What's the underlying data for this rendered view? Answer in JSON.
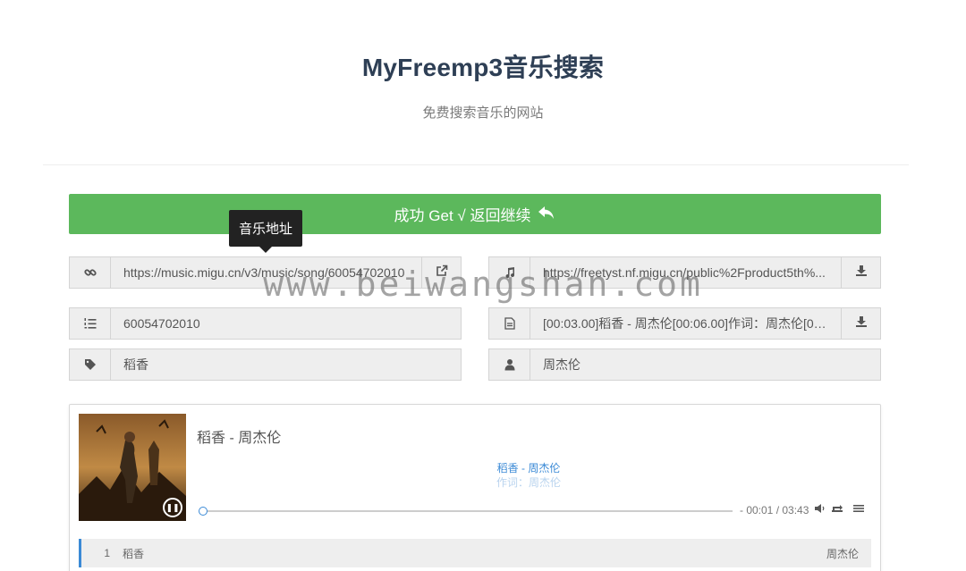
{
  "header": {
    "title": "MyFreemp3音乐搜索",
    "subtitle": "免费搜索音乐的网站"
  },
  "success_bar": {
    "label": "成功 Get √ 返回继续",
    "icon": "reply-icon",
    "color": "#5cb85c"
  },
  "tooltip": {
    "label": "音乐地址"
  },
  "fields": {
    "music_url": {
      "icon": "link-icon",
      "value": "https://music.migu.cn/v3/music/song/60054702010",
      "button_icon": "external-link-icon"
    },
    "file_url": {
      "icon": "music-note-icon",
      "value": "https://freetyst.nf.migu.cn/public%2Fproduct5th%...",
      "button_icon": "download-icon"
    },
    "song_id": {
      "icon": "list-ordered-icon",
      "value": "60054702010"
    },
    "lyrics": {
      "icon": "document-icon",
      "value": "[00:03.00]稻香 - 周杰伦[00:06.00]作词：周杰伦[00:...",
      "button_icon": "download-icon"
    },
    "song_name": {
      "icon": "tag-icon",
      "value": "稻香"
    },
    "artist": {
      "icon": "user-icon",
      "value": "周杰伦"
    }
  },
  "watermark": "www.beiwangshan.com",
  "player": {
    "title": "稻香 - 周杰伦",
    "lyric_current": "稻香 - 周杰伦",
    "lyric_next": "作词：周杰伦",
    "time": "- 00:01 / 03:43",
    "progress": 0.005,
    "accent": "#3b8ad6",
    "playlist": [
      {
        "index": "1",
        "name": "稻香",
        "artist": "周杰伦"
      }
    ]
  }
}
